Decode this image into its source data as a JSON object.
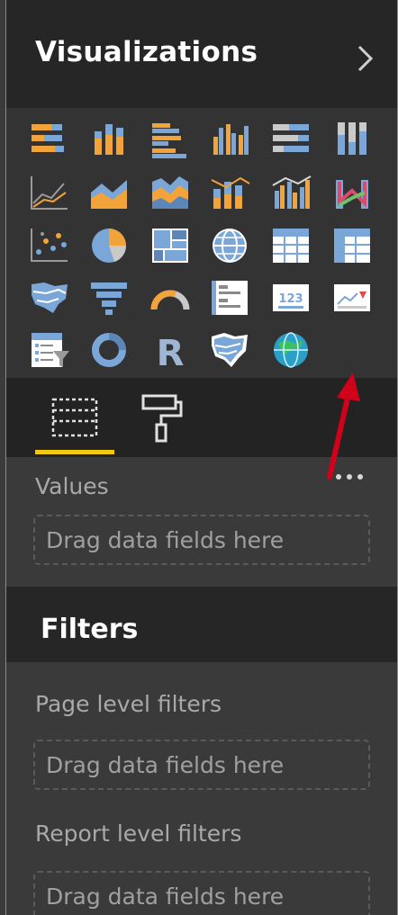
{
  "panel": {
    "title": "Visualizations",
    "expand_icon": "chevron-right-icon"
  },
  "visuals": [
    {
      "name": "stacked-bar-chart-icon"
    },
    {
      "name": "stacked-column-chart-icon"
    },
    {
      "name": "clustered-bar-chart-icon"
    },
    {
      "name": "clustered-column-chart-icon"
    },
    {
      "name": "100-percent-stacked-bar-chart-icon"
    },
    {
      "name": "100-percent-stacked-column-chart-icon"
    },
    {
      "name": "line-chart-icon"
    },
    {
      "name": "area-chart-icon"
    },
    {
      "name": "stacked-area-chart-icon"
    },
    {
      "name": "line-and-stacked-column-chart-icon"
    },
    {
      "name": "line-and-clustered-column-chart-icon"
    },
    {
      "name": "ribbon-chart-icon"
    },
    {
      "name": "scatter-chart-icon"
    },
    {
      "name": "pie-chart-icon"
    },
    {
      "name": "treemap-icon"
    },
    {
      "name": "map-icon"
    },
    {
      "name": "table-icon"
    },
    {
      "name": "matrix-icon"
    },
    {
      "name": "filled-map-icon"
    },
    {
      "name": "funnel-icon"
    },
    {
      "name": "gauge-icon"
    },
    {
      "name": "multi-row-card-icon"
    },
    {
      "name": "card-icon"
    },
    {
      "name": "kpi-icon"
    },
    {
      "name": "slicer-icon"
    },
    {
      "name": "donut-chart-icon"
    },
    {
      "name": "r-script-visual-icon"
    },
    {
      "name": "shape-map-icon"
    },
    {
      "name": "globe-map-icon"
    },
    {
      "name": "more-options-icon"
    }
  ],
  "card_text": "123",
  "r_text": "R",
  "tabs": [
    {
      "name": "fields-tab-icon",
      "active": true
    },
    {
      "name": "format-paint-roller-icon",
      "active": false
    }
  ],
  "values_section": {
    "label": "Values",
    "placeholder": "Drag data fields here"
  },
  "filters": {
    "title": "Filters",
    "page_level_label": "Page level filters",
    "page_level_placeholder": "Drag data fields here",
    "report_level_label": "Report level filters",
    "report_level_placeholder": "Drag data fields here"
  },
  "colors": {
    "accent_yellow": "#f2c811",
    "orange": "#f2a33a",
    "blue": "#7aa7d8",
    "annotation_red": "#d0021b"
  }
}
